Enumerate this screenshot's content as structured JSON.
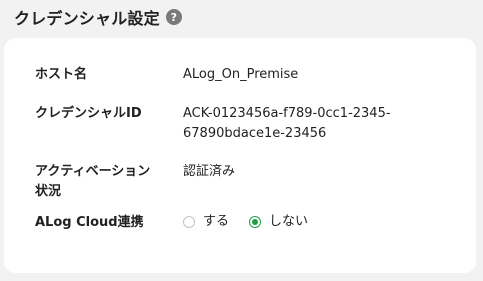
{
  "header": {
    "title": "クレデンシャル設定",
    "help_icon": "?"
  },
  "fields": {
    "host": {
      "label": "ホスト名",
      "value": "ALog_On_Premise"
    },
    "credential": {
      "label": "クレデンシャルID",
      "value_line1": "ACK-0123456a-f789-0cc1-2345-",
      "value_line2": "67890bdace1e-23456"
    },
    "activation": {
      "label_line1": "アクティベーション",
      "label_line2": "状況",
      "value": "認証済み"
    },
    "cloud": {
      "label": "ALog Cloud連携",
      "options": [
        {
          "label": "する",
          "checked": false
        },
        {
          "label": "しない",
          "checked": true
        }
      ]
    }
  },
  "colors": {
    "accent": "#1e9e43",
    "background": "#f2f2f2",
    "card": "#ffffff"
  }
}
